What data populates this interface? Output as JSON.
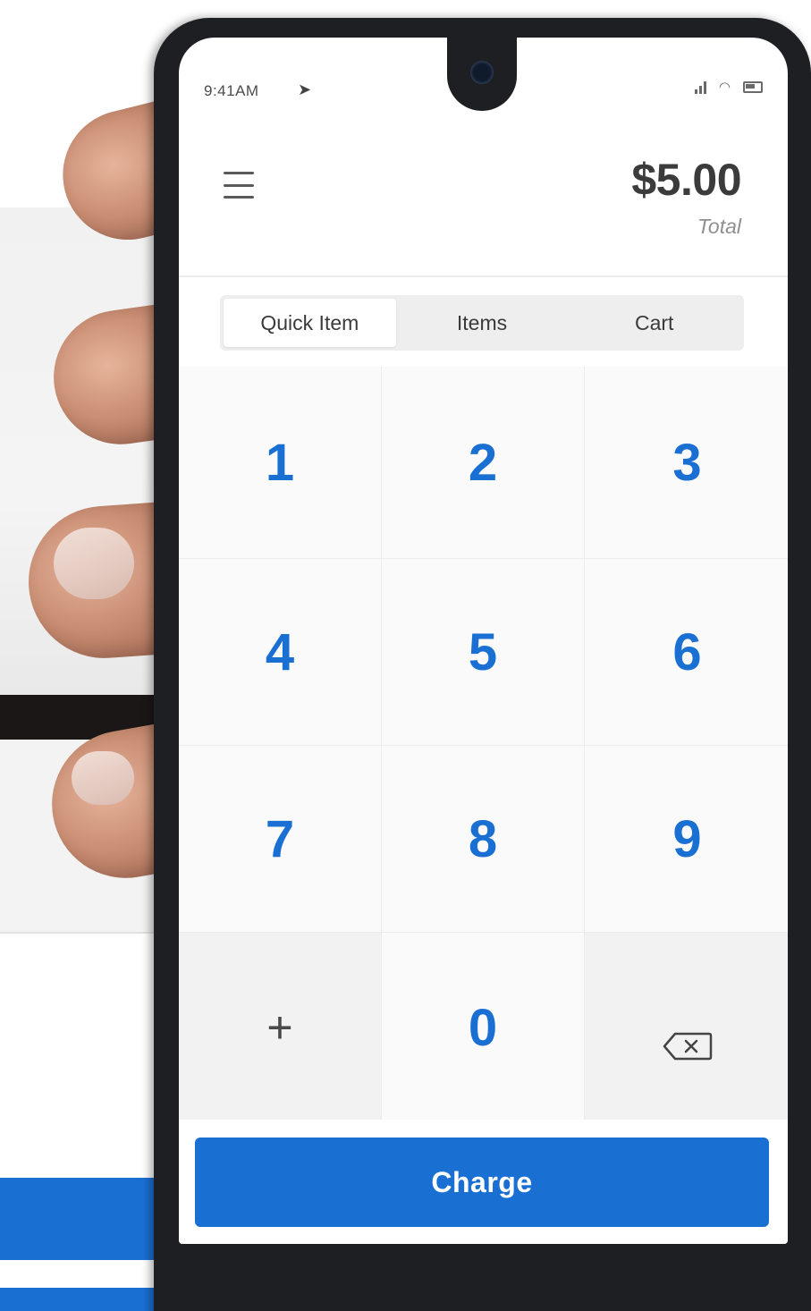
{
  "status_bar": {
    "time": "9:41AM"
  },
  "header": {
    "total_amount": "$5.00",
    "total_label": "Total"
  },
  "tabs": [
    {
      "label": "Quick Item",
      "active": true
    },
    {
      "label": "Items",
      "active": false
    },
    {
      "label": "Cart",
      "active": false
    }
  ],
  "keypad": {
    "keys": [
      "1",
      "2",
      "3",
      "4",
      "5",
      "6",
      "7",
      "8",
      "9",
      "+",
      "0"
    ],
    "delete_icon": "backspace-icon"
  },
  "charge": {
    "label": "Charge"
  },
  "colors": {
    "accent": "#1a6fd3",
    "text_dark": "#3b3b3b",
    "muted": "#8f8f8f"
  }
}
